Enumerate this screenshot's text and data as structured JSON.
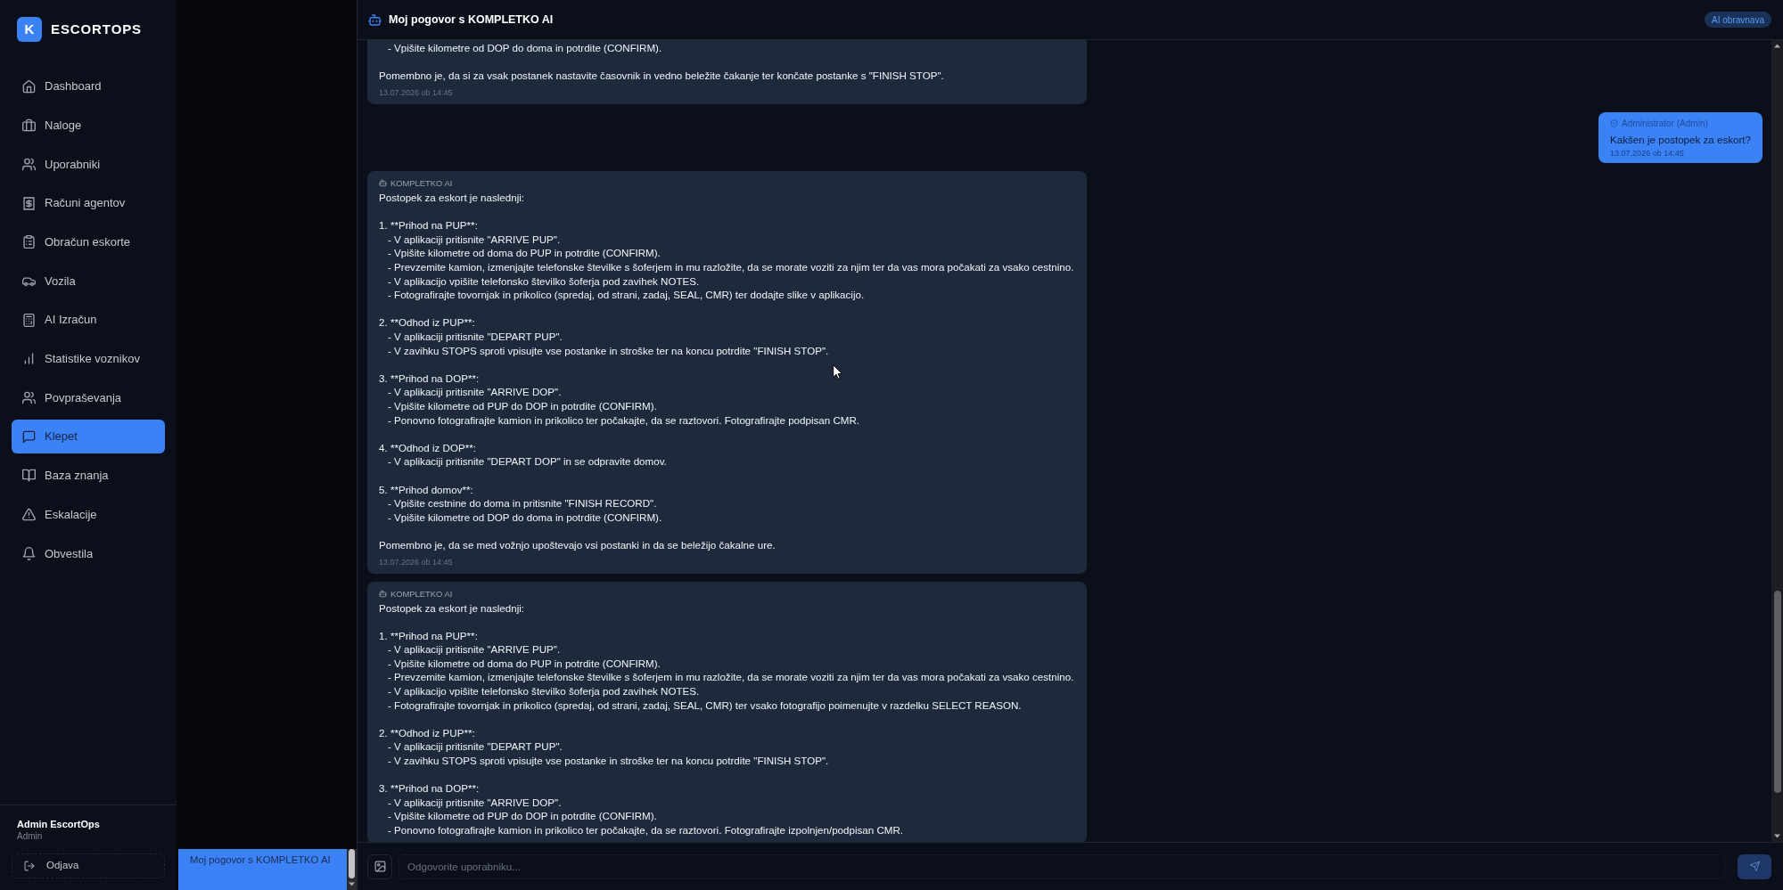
{
  "sidebar": {
    "logo_letter": "K",
    "brand": "ESCORTOPS",
    "items": [
      {
        "label": "Dashboard",
        "selected": false
      },
      {
        "label": "Naloge",
        "selected": false
      },
      {
        "label": "Uporabniki",
        "selected": false
      },
      {
        "label": "Računi agentov",
        "selected": false
      },
      {
        "label": "Obračun eskorte",
        "selected": false
      },
      {
        "label": "Vozila",
        "selected": false
      },
      {
        "label": "AI Izračun",
        "selected": false
      },
      {
        "label": "Statistike voznikov",
        "selected": false
      },
      {
        "label": "Povpraševanja",
        "selected": false
      },
      {
        "label": "Klepet",
        "selected": true
      },
      {
        "label": "Baza znanja",
        "selected": false
      },
      {
        "label": "Eskalacije",
        "selected": false
      },
      {
        "label": "Obvestila",
        "selected": false
      }
    ],
    "user": {
      "name": "Admin EscortOps",
      "role": "Admin"
    },
    "logout": "Odjava"
  },
  "conversations": [
    {
      "title": "Moj pogovor s KOMPLETKO AI",
      "selected": true
    }
  ],
  "chat": {
    "title": "Moj pogovor s KOMPLETKO AI",
    "badge": "AI obravnava",
    "messages": [
      {
        "kind": "ai",
        "blocks": [
          {
            "kind": "list",
            "items": [
              "- Vpišite kilometre od DOP do doma in potrdite (CONFIRM)."
            ]
          },
          {
            "kind": "text",
            "text": "Pomembno je, da si za vsak postanek nastavite časovnik in vedno beležite čakanje ter končate postanke s \"FINISH STOP\"."
          }
        ],
        "time": "13.07.2026 ob 14:45"
      },
      {
        "kind": "user",
        "sender": "Administrator (Admin)",
        "blocks": [
          {
            "kind": "text",
            "text": "Kakšen je postopek za eskort?"
          }
        ],
        "time": "13.07.2026 ob 14:45"
      },
      {
        "kind": "ai",
        "sender": "KOMPLETKO AI",
        "blocks": [
          {
            "kind": "text",
            "text": "Postopek za eskort je naslednji:"
          },
          {
            "kind": "list",
            "heading": "1. **Prihod na PUP**:",
            "items": [
              "- V aplikaciji pritisnite \"ARRIVE PUP\".",
              "- Vpišite kilometre od doma do PUP in potrdite (CONFIRM).",
              "- Prevzemite kamion, izmenjajte telefonske številke s šoferjem in mu razložite, da se morate voziti za njim ter da vas mora počakati za vsako cestnino.",
              "- V aplikacijo vpišite telefonsko številko šoferja pod zavihek NOTES.",
              "- Fotografirajte tovornjak in prikolico (spredaj, od strani, zadaj, SEAL, CMR) ter dodajte slike v aplikacijo."
            ]
          },
          {
            "kind": "list",
            "heading": "2. **Odhod iz PUP**:",
            "items": [
              "- V aplikaciji pritisnite \"DEPART PUP\".",
              "- V zavihku STOPS sproti vpisujte vse postanke in stroške ter na koncu potrdite \"FINISH STOP\"."
            ]
          },
          {
            "kind": "list",
            "heading": "3. **Prihod na DOP**:",
            "items": [
              "- V aplikaciji pritisnite \"ARRIVE DOP\".",
              "- Vpišite kilometre od PUP do DOP in potrdite (CONFIRM).",
              "- Ponovno fotografirajte kamion in prikolico ter počakajte, da se raztovori. Fotografirajte podpisan CMR."
            ]
          },
          {
            "kind": "list",
            "heading": "4. **Odhod iz DOP**:",
            "items": [
              "- V aplikaciji pritisnite \"DEPART DOP\" in se odpravite domov."
            ]
          },
          {
            "kind": "list",
            "heading": "5. **Prihod domov**:",
            "items": [
              "- Vpišite cestnine do doma in pritisnite \"FINISH RECORD\".",
              "- Vpišite kilometre od DOP do doma in potrdite (CONFIRM)."
            ]
          },
          {
            "kind": "text",
            "text": "Pomembno je, da se med vožnjo upoštevajo vsi postanki in da se beležijo čakalne ure."
          }
        ],
        "time": "13.07.2026 ob 14:45"
      },
      {
        "kind": "ai",
        "sender": "KOMPLETKO AI",
        "blocks": [
          {
            "kind": "text",
            "text": "Postopek za eskort je naslednji:"
          },
          {
            "kind": "list",
            "heading": "1. **Prihod na PUP**:",
            "items": [
              "- V aplikaciji pritisnite \"ARRIVE PUP\".",
              "- Vpišite kilometre od doma do PUP in potrdite (CONFIRM).",
              "- Prevzemite kamion, izmenjajte telefonske številke s šoferjem in mu razložite, da se morate voziti za njim ter da vas mora počakati za vsako cestnino.",
              "- V aplikacijo vpišite telefonsko številko šoferja pod zavihek NOTES.",
              "- Fotografirajte tovornjak in prikolico (spredaj, od strani, zadaj, SEAL, CMR) ter vsako fotografijo poimenujte v razdelku SELECT REASON."
            ]
          },
          {
            "kind": "list",
            "heading": "2. **Odhod iz PUP**:",
            "items": [
              "- V aplikaciji pritisnite \"DEPART PUP\".",
              "- V zavihku STOPS sproti vpisujte vse postanke in stroške ter na koncu potrdite \"FINISH STOP\"."
            ]
          },
          {
            "kind": "list",
            "heading": "3. **Prihod na DOP**:",
            "items": [
              "- V aplikaciji pritisnite \"ARRIVE DOP\".",
              "- Vpišite kilometre od PUP do DOP in potrdite (CONFIRM).",
              "- Ponovno fotografirajte kamion in prikolico ter počakajte, da se raztovori. Fotografirajte izpolnjen/podpisan CMR."
            ]
          }
        ]
      }
    ],
    "composer": {
      "placeholder": "Odgovorite uporabniku..."
    }
  }
}
